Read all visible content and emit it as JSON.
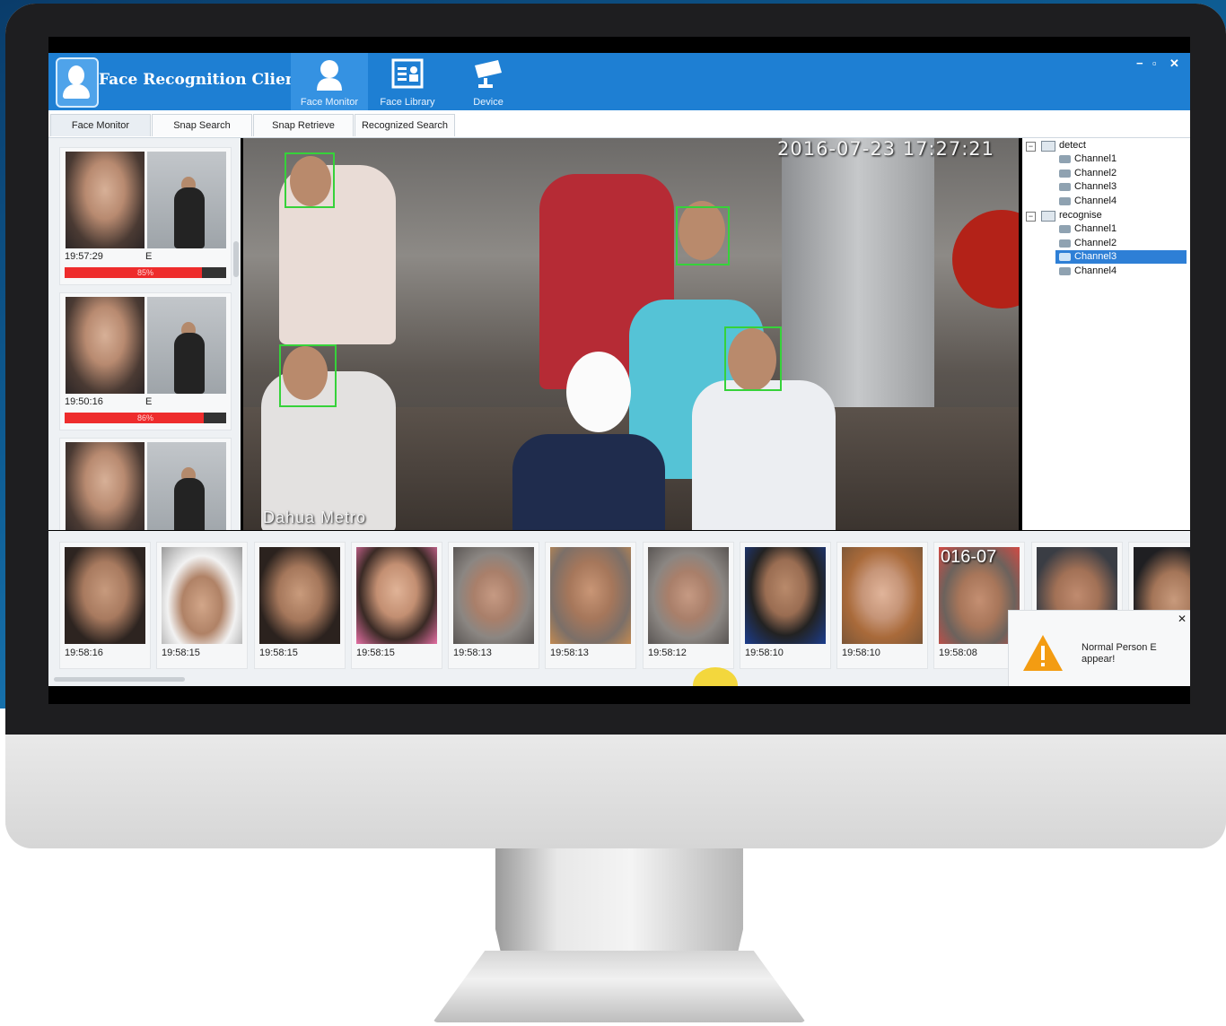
{
  "app": {
    "title": "Face Recognition Client"
  },
  "nav": [
    {
      "label": "Face Monitor",
      "icon": "person-icon",
      "active": true
    },
    {
      "label": "Face Library",
      "icon": "id-card-icon",
      "active": false
    },
    {
      "label": "Device",
      "icon": "camera-icon",
      "active": false
    }
  ],
  "window_controls": {
    "minimize": "−",
    "restore": "▫",
    "close": "✕"
  },
  "tabs": [
    "Face Monitor",
    "Snap Search",
    "Snap Retrieve",
    "Recognized Search"
  ],
  "matches": [
    {
      "time": "19:57:29",
      "tag": "E",
      "similarity": "85%",
      "similarity_value": 0.85
    },
    {
      "time": "19:50:16",
      "tag": "E",
      "similarity": "86%",
      "similarity_value": 0.86
    },
    {
      "time": "",
      "tag": "",
      "similarity": "",
      "similarity_value": 0
    }
  ],
  "video": {
    "timestamp": "2016-07-23 17:27:21",
    "channel_name": "Dahua Metro"
  },
  "tree": {
    "groups": [
      {
        "label": "detect",
        "channels": [
          "Channel1",
          "Channel2",
          "Channel3",
          "Channel4"
        ]
      },
      {
        "label": "recognise",
        "channels": [
          "Channel1",
          "Channel2",
          "Channel3",
          "Channel4"
        ]
      }
    ],
    "selected": "recognise/Channel3"
  },
  "snapshots": [
    {
      "time": "19:58:16"
    },
    {
      "time": "19:58:15"
    },
    {
      "time": "19:58:15"
    },
    {
      "time": "19:58:15"
    },
    {
      "time": "19:58:13"
    },
    {
      "time": "19:58:13"
    },
    {
      "time": "19:58:12"
    },
    {
      "time": "19:58:10"
    },
    {
      "time": "19:58:10"
    },
    {
      "time": "19:58:08"
    },
    {
      "time": ""
    },
    {
      "time": ""
    }
  ],
  "snapshot_overlay": "016-07",
  "notification": {
    "message": "Normal Person E appear!",
    "close": "✕"
  },
  "colors": {
    "accent": "#1e7fd3",
    "similarity_bar": "#ee2c2c",
    "face_box": "#36d23a",
    "warning": "#f39c12"
  }
}
